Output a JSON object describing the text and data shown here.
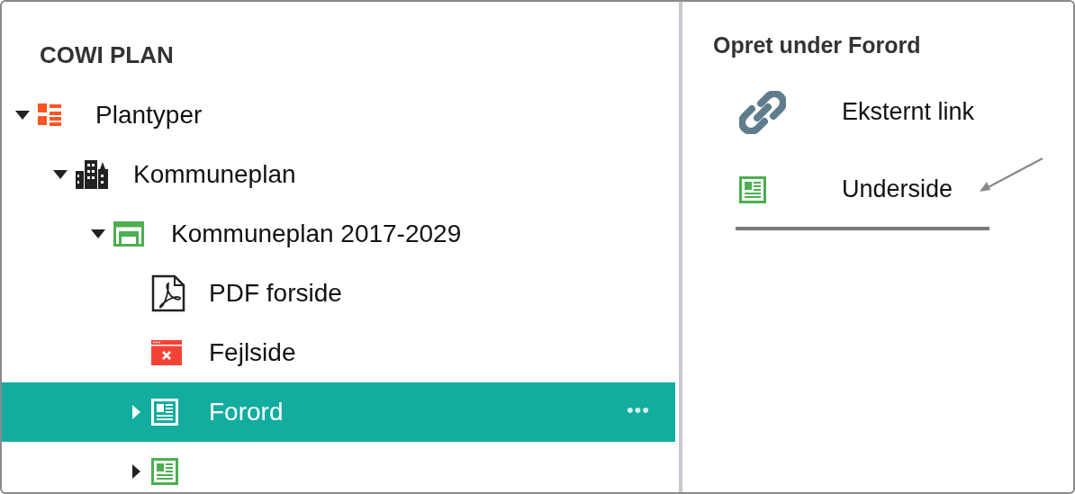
{
  "sidebar": {
    "title": "COWI PLAN",
    "tree": [
      {
        "label": "Plantyper",
        "kind": "plantypes",
        "expanded": true,
        "selected": false,
        "children": [
          {
            "label": "Kommuneplan",
            "kind": "city",
            "expanded": true,
            "selected": false,
            "children": [
              {
                "label": "Kommuneplan 2017-2029",
                "kind": "plan",
                "expanded": true,
                "selected": false,
                "children": [
                  {
                    "label": "PDF forside",
                    "kind": "pdf",
                    "selected": false
                  },
                  {
                    "label": "Fejlside",
                    "kind": "error",
                    "selected": false
                  },
                  {
                    "label": "Forord",
                    "kind": "page",
                    "expanded": false,
                    "selected": true,
                    "menu": "•••"
                  },
                  {
                    "kind": "page",
                    "expanded": false,
                    "selected": false
                  }
                ]
              }
            ]
          }
        ]
      }
    ]
  },
  "panel": {
    "title": "Opret under Forord",
    "options": [
      {
        "label": "Eksternt link",
        "kind": "link",
        "selected": false
      },
      {
        "label": "Underside",
        "kind": "page",
        "selected": true
      }
    ]
  }
}
